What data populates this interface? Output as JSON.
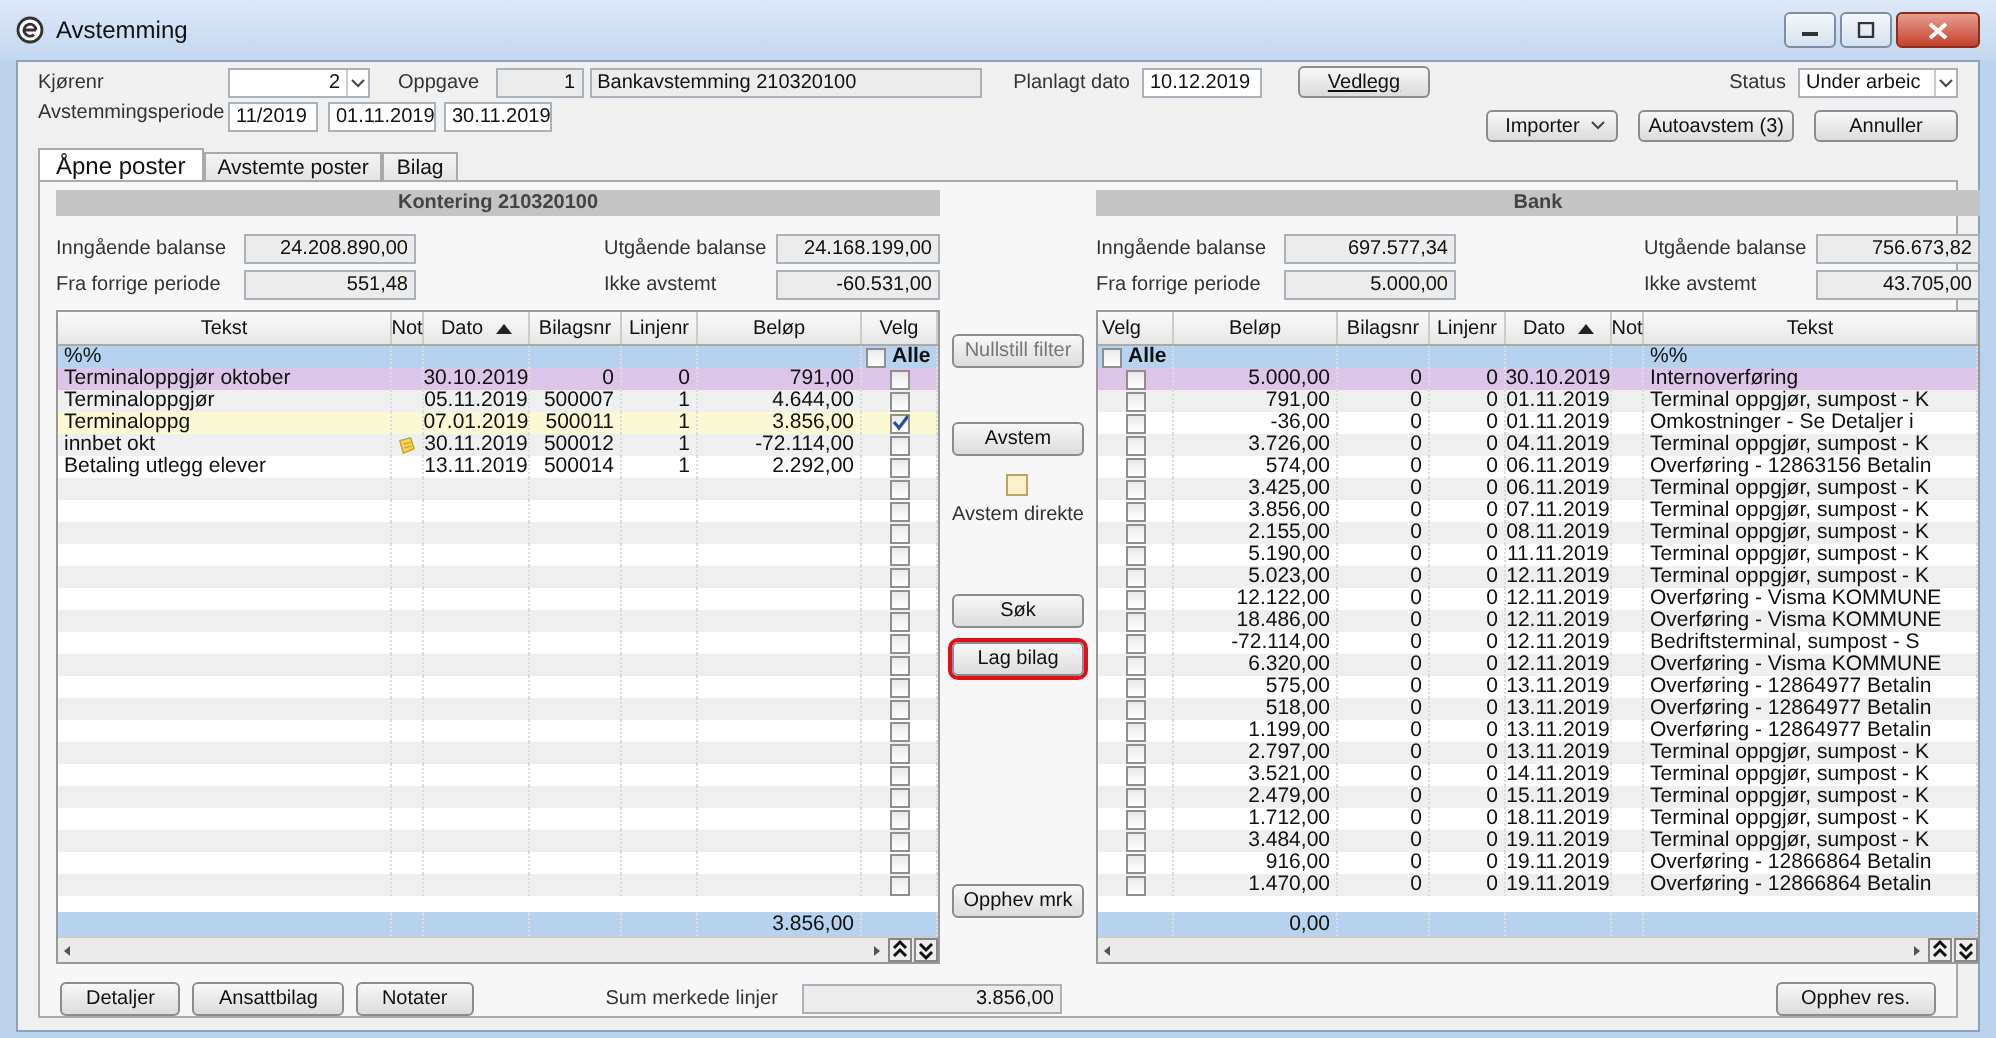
{
  "window": {
    "title": "Avstemming"
  },
  "form": {
    "kjorenr": {
      "label": "Kjørenr",
      "value": "2"
    },
    "oppgave": {
      "label": "Oppgave",
      "number": "1",
      "name": "Bankavstemming 210320100"
    },
    "planlagt_dato": {
      "label": "Planlagt dato",
      "value": "10.12.2019"
    },
    "vedlegg": "Vedlegg",
    "status": {
      "label": "Status",
      "value": "Under arbeic"
    },
    "periode": {
      "label": "Avstemmingsperiode",
      "period": "11/2019",
      "from": "01.11.2019",
      "to": "30.11.2019"
    },
    "importer": "Importer",
    "autoavstem": "Autoavstem (3)",
    "annuller": "Annuller"
  },
  "tabs": [
    {
      "label": "Åpne poster",
      "selected": true
    },
    {
      "label": "Avstemte poster",
      "selected": false
    },
    {
      "label": "Bilag",
      "selected": false
    }
  ],
  "panels": [
    {
      "title": "Kontering 210320100",
      "balances": [
        {
          "label": "Inngående balanse",
          "value": "24.208.890,00"
        },
        {
          "label": "Utgående balanse",
          "value": "24.168.199,00"
        },
        {
          "label": "Fra forrige periode",
          "value": "551,48"
        },
        {
          "label": "Ikke avstemt",
          "value": "-60.531,00"
        }
      ],
      "columns": [
        {
          "kind": "tekst",
          "label": "Tekst",
          "sorted": false
        },
        {
          "kind": "not",
          "label": "Not",
          "sorted": false
        },
        {
          "kind": "dato",
          "label": "Dato",
          "sorted": true
        },
        {
          "kind": "bilagsnr",
          "label": "Bilagsnr",
          "sorted": false
        },
        {
          "kind": "linjenr",
          "label": "Linjenr",
          "sorted": false
        },
        {
          "kind": "belop",
          "label": "Beløp",
          "sorted": false
        },
        {
          "kind": "velg",
          "label": "Velg",
          "sorted": false
        }
      ],
      "filter": {
        "tekst": "%%",
        "all_label": "Alle",
        "checked": false
      },
      "rows": [
        {
          "kind": "marked",
          "tekst": "Terminaloppgjør oktober",
          "note": false,
          "dato": "30.10.2019",
          "bilagsnr": "0",
          "linjenr": "0",
          "belop": "791,00",
          "checked": false
        },
        {
          "kind": "normal",
          "tekst": "Terminaloppgjør",
          "note": false,
          "dato": "05.11.2019",
          "bilagsnr": "500007",
          "linjenr": "1",
          "belop": "4.644,00",
          "checked": false
        },
        {
          "kind": "normal",
          "tekst": "Terminaloppg",
          "note": false,
          "dato": "07.01.2019",
          "bilagsnr": "500011",
          "linjenr": "1",
          "belop": "3.856,00",
          "checked": true
        },
        {
          "kind": "normal",
          "tekst": "innbet okt",
          "note": true,
          "dato": "30.11.2019",
          "bilagsnr": "500012",
          "linjenr": "1",
          "belop": "-72.114,00",
          "checked": false
        },
        {
          "kind": "normal",
          "tekst": "Betaling utlegg elever",
          "note": false,
          "dato": "13.11.2019",
          "bilagsnr": "500014",
          "linjenr": "1",
          "belop": "2.292,00",
          "checked": false
        }
      ],
      "empty_rows": [
        {
          "checked": false
        },
        {
          "checked": false
        },
        {
          "checked": false
        },
        {
          "checked": false
        },
        {
          "checked": false
        },
        {
          "checked": false
        },
        {
          "checked": false
        },
        {
          "checked": false
        },
        {
          "checked": false
        },
        {
          "checked": false
        },
        {
          "checked": false
        },
        {
          "checked": false
        },
        {
          "checked": false
        },
        {
          "checked": false
        },
        {
          "checked": false
        },
        {
          "checked": false
        },
        {
          "checked": false
        },
        {
          "checked": false
        },
        {
          "checked": false
        }
      ],
      "sum": "3.856,00"
    },
    {
      "title": "Bank",
      "balances": [
        {
          "label": "Inngående balanse",
          "value": "697.577,34"
        },
        {
          "label": "Utgående balanse",
          "value": "756.673,82"
        },
        {
          "label": "Fra forrige periode",
          "value": "5.000,00"
        },
        {
          "label": "Ikke avstemt",
          "value": "43.705,00"
        }
      ],
      "columns": [
        {
          "kind": "velg",
          "label": "Velg",
          "sorted": false
        },
        {
          "kind": "belop",
          "label": "Beløp",
          "sorted": false
        },
        {
          "kind": "bilagsnr",
          "label": "Bilagsnr",
          "sorted": false
        },
        {
          "kind": "linjenr",
          "label": "Linjenr",
          "sorted": false
        },
        {
          "kind": "dato",
          "label": "Dato",
          "sorted": true
        },
        {
          "kind": "not",
          "label": "Not",
          "sorted": false
        },
        {
          "kind": "tekst",
          "label": "Tekst",
          "sorted": false
        }
      ],
      "filter": {
        "tekst": "%%",
        "all_label": "Alle",
        "checked": false
      },
      "rows": [
        {
          "kind": "marked",
          "belop": "5.000,00",
          "bilagsnr": "0",
          "linjenr": "0",
          "dato": "30.10.2019",
          "note": false,
          "tekst": "Internoverføring",
          "checked": false
        },
        {
          "kind": "normal",
          "belop": "791,00",
          "bilagsnr": "0",
          "linjenr": "0",
          "dato": "01.11.2019",
          "note": false,
          "tekst": "Terminal oppgjør, sumpost - K",
          "checked": false
        },
        {
          "kind": "normal",
          "belop": "-36,00",
          "bilagsnr": "0",
          "linjenr": "0",
          "dato": "01.11.2019",
          "note": false,
          "tekst": "Omkostninger - Se Detaljer i",
          "checked": false
        },
        {
          "kind": "normal",
          "belop": "3.726,00",
          "bilagsnr": "0",
          "linjenr": "0",
          "dato": "04.11.2019",
          "note": false,
          "tekst": "Terminal oppgjør, sumpost - K",
          "checked": false
        },
        {
          "kind": "normal",
          "belop": "574,00",
          "bilagsnr": "0",
          "linjenr": "0",
          "dato": "06.11.2019",
          "note": false,
          "tekst": "Overføring - 12863156 Betalin",
          "checked": false
        },
        {
          "kind": "normal",
          "belop": "3.425,00",
          "bilagsnr": "0",
          "linjenr": "0",
          "dato": "06.11.2019",
          "note": false,
          "tekst": "Terminal oppgjør, sumpost - K",
          "checked": false
        },
        {
          "kind": "normal",
          "belop": "3.856,00",
          "bilagsnr": "0",
          "linjenr": "0",
          "dato": "07.11.2019",
          "note": false,
          "tekst": "Terminal oppgjør, sumpost - K",
          "checked": false
        },
        {
          "kind": "normal",
          "belop": "2.155,00",
          "bilagsnr": "0",
          "linjenr": "0",
          "dato": "08.11.2019",
          "note": false,
          "tekst": "Terminal oppgjør, sumpost - K",
          "checked": false
        },
        {
          "kind": "normal",
          "belop": "5.190,00",
          "bilagsnr": "0",
          "linjenr": "0",
          "dato": "11.11.2019",
          "note": false,
          "tekst": "Terminal oppgjør, sumpost - K",
          "checked": false
        },
        {
          "kind": "normal",
          "belop": "5.023,00",
          "bilagsnr": "0",
          "linjenr": "0",
          "dato": "12.11.2019",
          "note": false,
          "tekst": "Terminal oppgjør, sumpost - K",
          "checked": false
        },
        {
          "kind": "normal",
          "belop": "12.122,00",
          "bilagsnr": "0",
          "linjenr": "0",
          "dato": "12.11.2019",
          "note": false,
          "tekst": "Overføring - Visma KOMMUNE",
          "checked": false
        },
        {
          "kind": "normal",
          "belop": "18.486,00",
          "bilagsnr": "0",
          "linjenr": "0",
          "dato": "12.11.2019",
          "note": false,
          "tekst": "Overføring - Visma KOMMUNE",
          "checked": false
        },
        {
          "kind": "normal",
          "belop": "-72.114,00",
          "bilagsnr": "0",
          "linjenr": "0",
          "dato": "12.11.2019",
          "note": false,
          "tekst": "Bedriftsterminal, sumpost - S",
          "checked": false
        },
        {
          "kind": "normal",
          "belop": "6.320,00",
          "bilagsnr": "0",
          "linjenr": "0",
          "dato": "12.11.2019",
          "note": false,
          "tekst": "Overføring - Visma KOMMUNE",
          "checked": false
        },
        {
          "kind": "normal",
          "belop": "575,00",
          "bilagsnr": "0",
          "linjenr": "0",
          "dato": "13.11.2019",
          "note": false,
          "tekst": "Overføring - 12864977 Betalin",
          "checked": false
        },
        {
          "kind": "normal",
          "belop": "518,00",
          "bilagsnr": "0",
          "linjenr": "0",
          "dato": "13.11.2019",
          "note": false,
          "tekst": "Overføring - 12864977 Betalin",
          "checked": false
        },
        {
          "kind": "normal",
          "belop": "1.199,00",
          "bilagsnr": "0",
          "linjenr": "0",
          "dato": "13.11.2019",
          "note": false,
          "tekst": "Overføring - 12864977 Betalin",
          "checked": false
        },
        {
          "kind": "normal",
          "belop": "2.797,00",
          "bilagsnr": "0",
          "linjenr": "0",
          "dato": "13.11.2019",
          "note": false,
          "tekst": "Terminal oppgjør, sumpost - K",
          "checked": false
        },
        {
          "kind": "normal",
          "belop": "3.521,00",
          "bilagsnr": "0",
          "linjenr": "0",
          "dato": "14.11.2019",
          "note": false,
          "tekst": "Terminal oppgjør, sumpost - K",
          "checked": false
        },
        {
          "kind": "normal",
          "belop": "2.479,00",
          "bilagsnr": "0",
          "linjenr": "0",
          "dato": "15.11.2019",
          "note": false,
          "tekst": "Terminal oppgjør, sumpost - K",
          "checked": false
        },
        {
          "kind": "normal",
          "belop": "1.712,00",
          "bilagsnr": "0",
          "linjenr": "0",
          "dato": "18.11.2019",
          "note": false,
          "tekst": "Terminal oppgjør, sumpost - K",
          "checked": false
        },
        {
          "kind": "normal",
          "belop": "3.484,00",
          "bilagsnr": "0",
          "linjenr": "0",
          "dato": "19.11.2019",
          "note": false,
          "tekst": "Terminal oppgjør, sumpost - K",
          "checked": false
        },
        {
          "kind": "normal",
          "belop": "916,00",
          "bilagsnr": "0",
          "linjenr": "0",
          "dato": "19.11.2019",
          "note": false,
          "tekst": "Overføring - 12866864 Betalin",
          "checked": false
        },
        {
          "kind": "normal",
          "belop": "1.470,00",
          "bilagsnr": "0",
          "linjenr": "0",
          "dato": "19.11.2019",
          "note": false,
          "tekst": "Overføring - 12866864 Betalin",
          "checked": false
        }
      ],
      "sum": "0,00"
    }
  ],
  "middle": [
    {
      "kind": "button",
      "label": "Nullstill filter",
      "disabled": true,
      "highlighted": false
    },
    {
      "kind": "button",
      "label": "Avstem",
      "disabled": false,
      "highlighted": false
    },
    {
      "kind": "checkbox",
      "label": "Avstem direkte",
      "checked": false
    },
    {
      "kind": "button",
      "label": "Søk",
      "disabled": false,
      "highlighted": false
    },
    {
      "kind": "button",
      "label": "Lag bilag",
      "disabled": false,
      "highlighted": true
    },
    {
      "kind": "button",
      "label": "Opphev mrk",
      "disabled": false,
      "highlighted": false
    }
  ],
  "bottom": {
    "buttons": [
      "Detaljer",
      "Ansattbilag",
      "Notater"
    ],
    "sum_label": "Sum merkede linjer",
    "sum_value": "3.856,00",
    "reset": "Opphev res."
  }
}
